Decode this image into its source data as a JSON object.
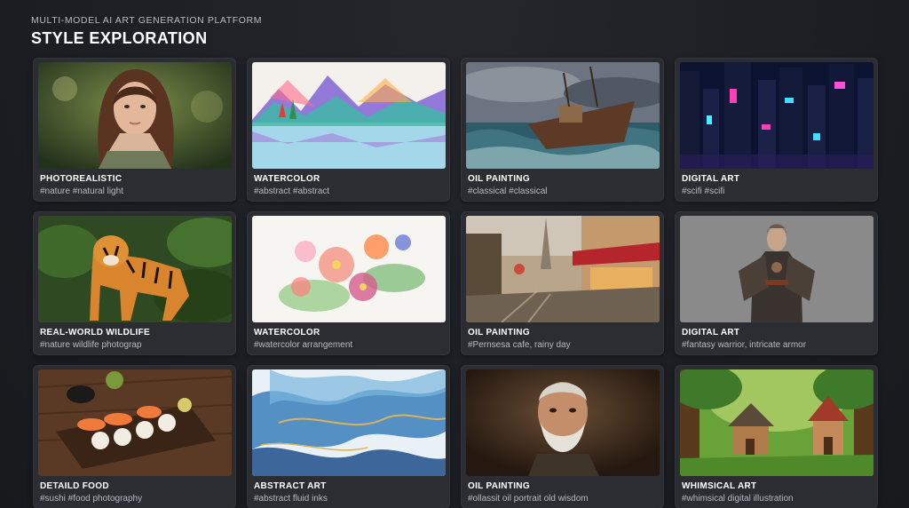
{
  "header": {
    "subtitle": "MULTI-MODEL AI ART GENERATION PLATFORM",
    "title": "STYLE EXPLORATION"
  },
  "cards": [
    {
      "style": "PHOTOREALISTIC",
      "tags": "#nature #natural light",
      "image": "portrait-woman-forest"
    },
    {
      "style": "WATERCOLOR",
      "tags": "#abstract #abstract",
      "image": "watercolor-mountain-lake"
    },
    {
      "style": "OIL PAINTING",
      "tags": "#classical #classical",
      "image": "boat-stormy-sea"
    },
    {
      "style": "DIGITAL ART",
      "tags": "#scifi #scifi",
      "image": "neon-cyberpunk-city"
    },
    {
      "style": "REAL-WORLD WILDLIFE",
      "tags": "#nature wildlife photograp",
      "image": "tiger-jungle"
    },
    {
      "style": "WATERCOLOR",
      "tags": "#watercolor arrangement",
      "image": "watercolor-flowers"
    },
    {
      "style": "OIL PAINTING",
      "tags": "#Pernsesa cafe, rainy day",
      "image": "paris-cafe-rain"
    },
    {
      "style": "DIGITAL ART",
      "tags": "#fantasy warrior, intricate armor",
      "image": "armored-warrior"
    },
    {
      "style": "DETAILD FOOD",
      "tags": "#sushi #food photography",
      "image": "sushi-board"
    },
    {
      "style": "ABSTRACT ART",
      "tags": "#abstract fluid inks",
      "image": "blue-fluid-ink"
    },
    {
      "style": "OIL PAINTING",
      "tags": "#ollassit oil portrait old wisdom",
      "image": "old-man-portrait"
    },
    {
      "style": "WHIMSICAL ART",
      "tags": "#whimsical digital illustration",
      "image": "fairytale-cottages"
    }
  ]
}
